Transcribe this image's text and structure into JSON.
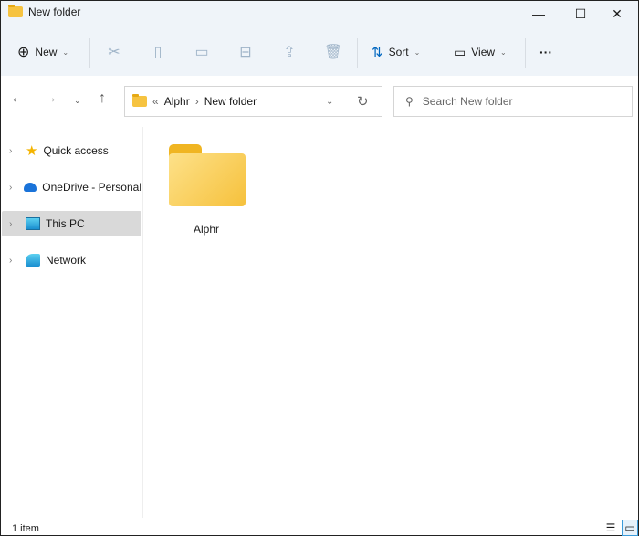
{
  "window": {
    "title": "New folder"
  },
  "toolbar": {
    "new_label": "New",
    "sort_label": "Sort",
    "view_label": "View",
    "more": "···"
  },
  "address": {
    "overflow": "«",
    "crumbs": [
      "Alphr",
      "New folder"
    ]
  },
  "search": {
    "placeholder": "Search New folder"
  },
  "nav_pane": {
    "items": [
      {
        "label": "Quick access"
      },
      {
        "label": "OneDrive - Personal"
      },
      {
        "label": "This PC",
        "selected": true
      },
      {
        "label": "Network"
      }
    ]
  },
  "content": {
    "items": [
      {
        "name": "Alphr",
        "type": "folder"
      }
    ]
  },
  "status": {
    "count": "1 item"
  },
  "colors": {
    "accent": "#0067c0",
    "folder": "#f6c340",
    "chrome": "#eff4f9"
  }
}
